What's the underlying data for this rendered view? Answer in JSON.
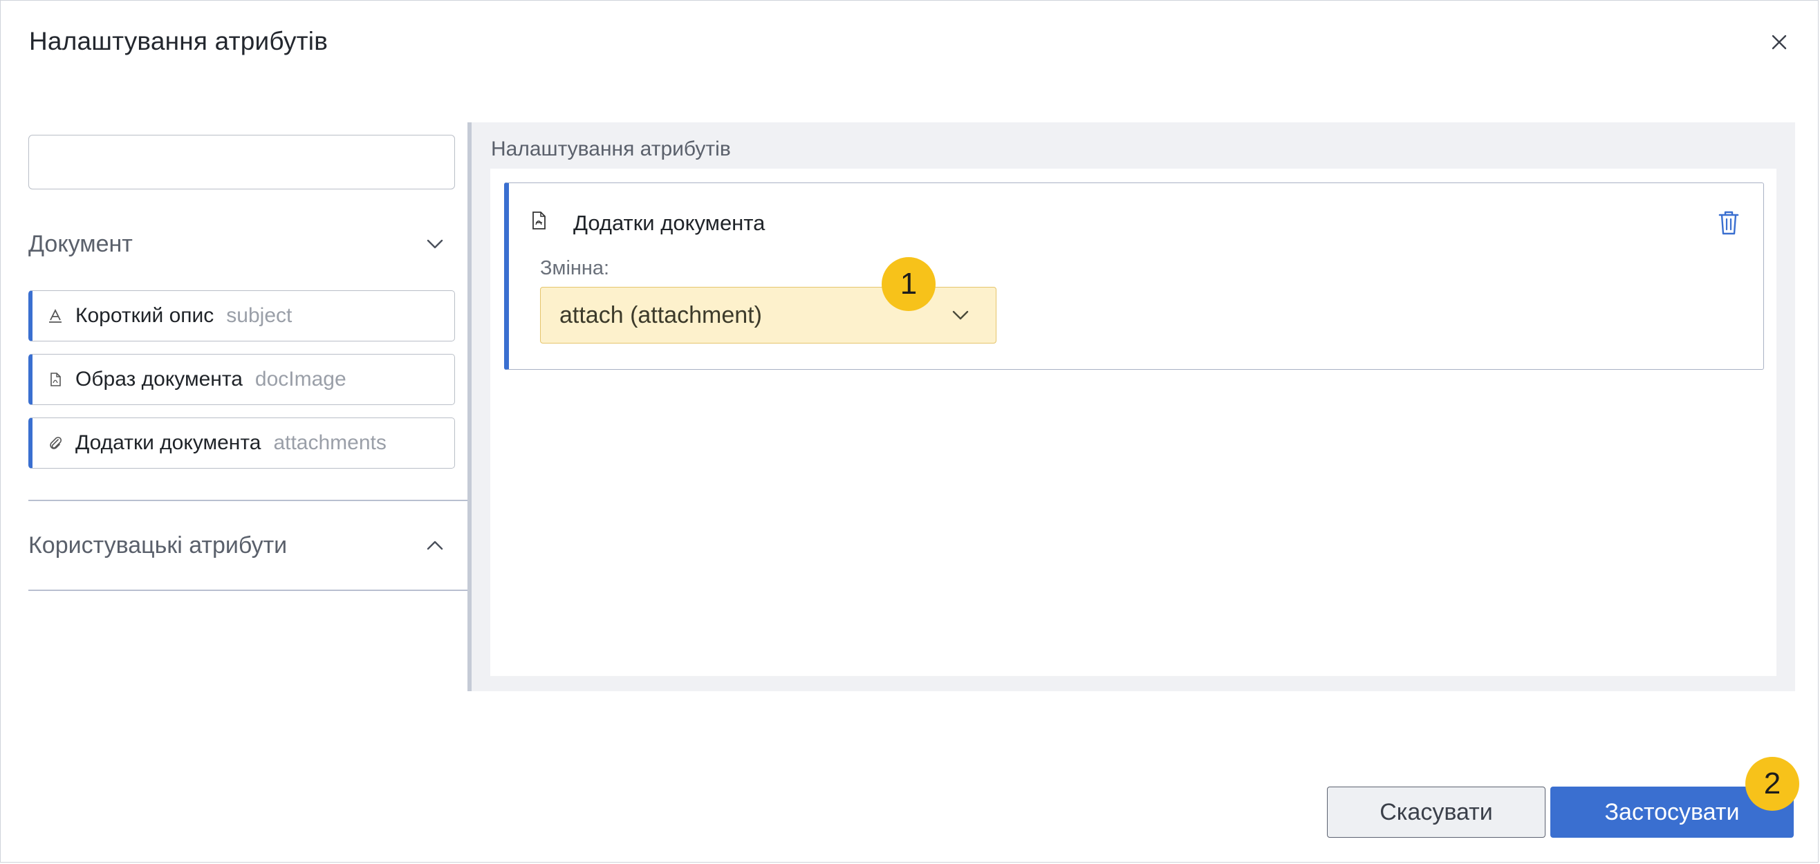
{
  "dialog": {
    "title": "Налаштування атрибутів"
  },
  "left_panel": {
    "search": {
      "value": "",
      "placeholder": ""
    },
    "sections": [
      {
        "label": "Документ",
        "expanded": true,
        "items": [
          {
            "name": "Короткий опис",
            "code": "subject",
            "icon": "text-field-icon"
          },
          {
            "name": "Образ документа",
            "code": "docImage",
            "icon": "pdf-file-icon"
          },
          {
            "name": "Додатки документа",
            "code": "attachments",
            "icon": "paperclip-icon"
          }
        ]
      },
      {
        "label": "Користувацькі атрибути",
        "expanded": false
      }
    ]
  },
  "right_panel": {
    "title": "Налаштування атрибутів",
    "card": {
      "title": "Додатки документа",
      "icon": "pdf-file-icon",
      "variable_label": "Змінна:",
      "variable_value": "attach (attachment)"
    }
  },
  "footer": {
    "cancel_label": "Скасувати",
    "apply_label": "Застосувати"
  },
  "callouts": [
    "1",
    "2"
  ],
  "colors": {
    "accent": "#3a6fd0",
    "highlight_fill": "#fdf1cc",
    "badge": "#f7c21a"
  }
}
